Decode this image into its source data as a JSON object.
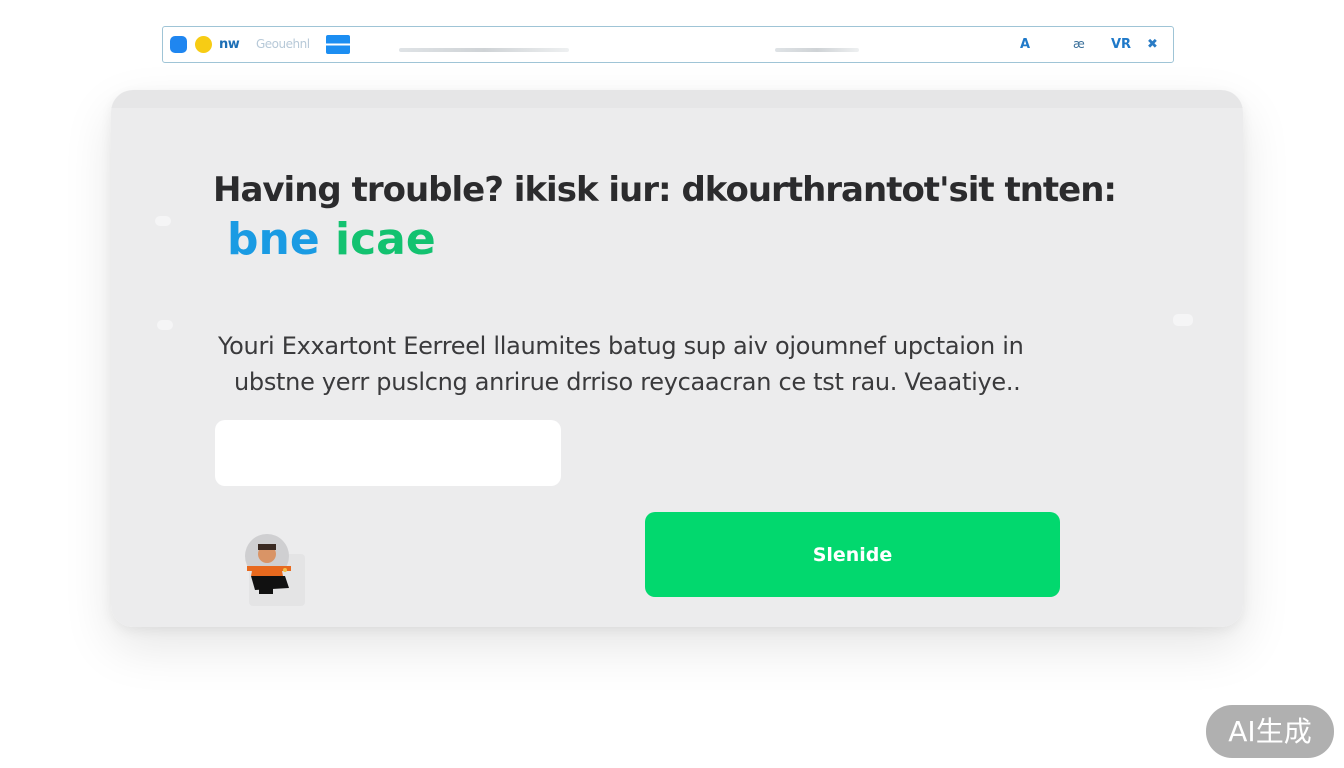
{
  "toolbar": {
    "brand_text": "nw",
    "brand_faded_text": "Geouehnl",
    "icons": [
      "a-icon",
      "x-icon",
      "vr-icon",
      "k-icon"
    ],
    "icon_glyphs": [
      "A",
      "æ",
      "VR",
      "✖"
    ]
  },
  "card": {
    "heading": "Having trouble? ikisk iur: dkourthrantot'sit tnten:",
    "sub_heading": {
      "word1": "bne",
      "word2": "icae"
    },
    "body": {
      "line1": "Youri Exxartont Eerreel llaumites batug sup aiv ojoumnef upctaion in",
      "line2": "ubstne yerr puslcng anrirue drriso reycaacran ce tst rau. Veaatiye.."
    },
    "input": {
      "value": "",
      "placeholder": ""
    },
    "send_button_label": "Slenide"
  },
  "watermark": "AI生成",
  "colors": {
    "accent_green": "#02d86e",
    "accent_blue": "#1a9be3",
    "sub_green": "#13c270",
    "card_bg": "#ececed"
  }
}
